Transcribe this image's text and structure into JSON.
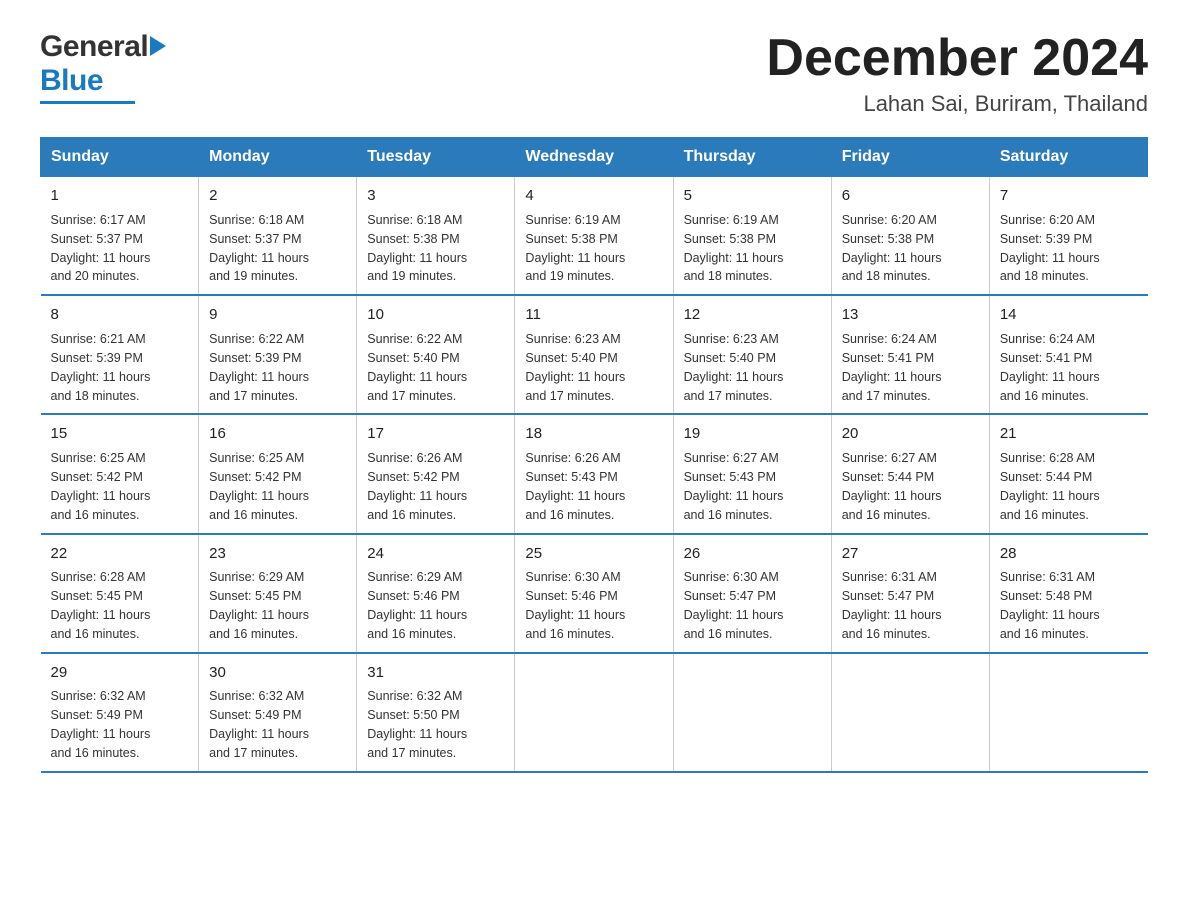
{
  "header": {
    "logo_general": "General",
    "logo_blue": "Blue",
    "month_title": "December 2024",
    "location": "Lahan Sai, Buriram, Thailand"
  },
  "days_of_week": [
    "Sunday",
    "Monday",
    "Tuesday",
    "Wednesday",
    "Thursday",
    "Friday",
    "Saturday"
  ],
  "weeks": [
    [
      {
        "day": "1",
        "sunrise": "6:17 AM",
        "sunset": "5:37 PM",
        "daylight": "11 hours and 20 minutes."
      },
      {
        "day": "2",
        "sunrise": "6:18 AM",
        "sunset": "5:37 PM",
        "daylight": "11 hours and 19 minutes."
      },
      {
        "day": "3",
        "sunrise": "6:18 AM",
        "sunset": "5:38 PM",
        "daylight": "11 hours and 19 minutes."
      },
      {
        "day": "4",
        "sunrise": "6:19 AM",
        "sunset": "5:38 PM",
        "daylight": "11 hours and 19 minutes."
      },
      {
        "day": "5",
        "sunrise": "6:19 AM",
        "sunset": "5:38 PM",
        "daylight": "11 hours and 18 minutes."
      },
      {
        "day": "6",
        "sunrise": "6:20 AM",
        "sunset": "5:38 PM",
        "daylight": "11 hours and 18 minutes."
      },
      {
        "day": "7",
        "sunrise": "6:20 AM",
        "sunset": "5:39 PM",
        "daylight": "11 hours and 18 minutes."
      }
    ],
    [
      {
        "day": "8",
        "sunrise": "6:21 AM",
        "sunset": "5:39 PM",
        "daylight": "11 hours and 18 minutes."
      },
      {
        "day": "9",
        "sunrise": "6:22 AM",
        "sunset": "5:39 PM",
        "daylight": "11 hours and 17 minutes."
      },
      {
        "day": "10",
        "sunrise": "6:22 AM",
        "sunset": "5:40 PM",
        "daylight": "11 hours and 17 minutes."
      },
      {
        "day": "11",
        "sunrise": "6:23 AM",
        "sunset": "5:40 PM",
        "daylight": "11 hours and 17 minutes."
      },
      {
        "day": "12",
        "sunrise": "6:23 AM",
        "sunset": "5:40 PM",
        "daylight": "11 hours and 17 minutes."
      },
      {
        "day": "13",
        "sunrise": "6:24 AM",
        "sunset": "5:41 PM",
        "daylight": "11 hours and 17 minutes."
      },
      {
        "day": "14",
        "sunrise": "6:24 AM",
        "sunset": "5:41 PM",
        "daylight": "11 hours and 16 minutes."
      }
    ],
    [
      {
        "day": "15",
        "sunrise": "6:25 AM",
        "sunset": "5:42 PM",
        "daylight": "11 hours and 16 minutes."
      },
      {
        "day": "16",
        "sunrise": "6:25 AM",
        "sunset": "5:42 PM",
        "daylight": "11 hours and 16 minutes."
      },
      {
        "day": "17",
        "sunrise": "6:26 AM",
        "sunset": "5:42 PM",
        "daylight": "11 hours and 16 minutes."
      },
      {
        "day": "18",
        "sunrise": "6:26 AM",
        "sunset": "5:43 PM",
        "daylight": "11 hours and 16 minutes."
      },
      {
        "day": "19",
        "sunrise": "6:27 AM",
        "sunset": "5:43 PM",
        "daylight": "11 hours and 16 minutes."
      },
      {
        "day": "20",
        "sunrise": "6:27 AM",
        "sunset": "5:44 PM",
        "daylight": "11 hours and 16 minutes."
      },
      {
        "day": "21",
        "sunrise": "6:28 AM",
        "sunset": "5:44 PM",
        "daylight": "11 hours and 16 minutes."
      }
    ],
    [
      {
        "day": "22",
        "sunrise": "6:28 AM",
        "sunset": "5:45 PM",
        "daylight": "11 hours and 16 minutes."
      },
      {
        "day": "23",
        "sunrise": "6:29 AM",
        "sunset": "5:45 PM",
        "daylight": "11 hours and 16 minutes."
      },
      {
        "day": "24",
        "sunrise": "6:29 AM",
        "sunset": "5:46 PM",
        "daylight": "11 hours and 16 minutes."
      },
      {
        "day": "25",
        "sunrise": "6:30 AM",
        "sunset": "5:46 PM",
        "daylight": "11 hours and 16 minutes."
      },
      {
        "day": "26",
        "sunrise": "6:30 AM",
        "sunset": "5:47 PM",
        "daylight": "11 hours and 16 minutes."
      },
      {
        "day": "27",
        "sunrise": "6:31 AM",
        "sunset": "5:47 PM",
        "daylight": "11 hours and 16 minutes."
      },
      {
        "day": "28",
        "sunrise": "6:31 AM",
        "sunset": "5:48 PM",
        "daylight": "11 hours and 16 minutes."
      }
    ],
    [
      {
        "day": "29",
        "sunrise": "6:32 AM",
        "sunset": "5:49 PM",
        "daylight": "11 hours and 16 minutes."
      },
      {
        "day": "30",
        "sunrise": "6:32 AM",
        "sunset": "5:49 PM",
        "daylight": "11 hours and 17 minutes."
      },
      {
        "day": "31",
        "sunrise": "6:32 AM",
        "sunset": "5:50 PM",
        "daylight": "11 hours and 17 minutes."
      },
      null,
      null,
      null,
      null
    ]
  ],
  "sunrise_label": "Sunrise: ",
  "sunset_label": "Sunset: ",
  "daylight_label": "Daylight: "
}
